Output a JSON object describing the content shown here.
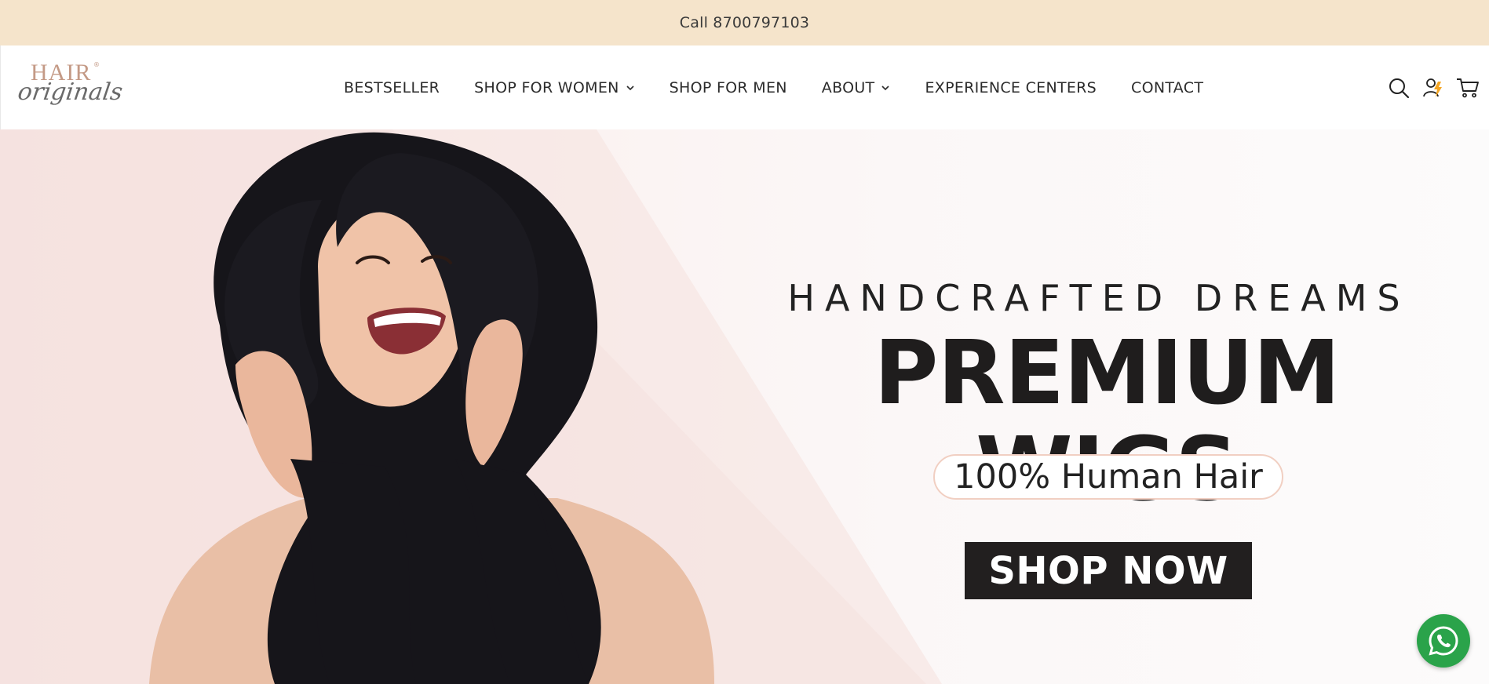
{
  "announcement": {
    "text": "Call 8700797103"
  },
  "logo": {
    "line1": "HAIR",
    "line2": "originals"
  },
  "nav": {
    "items": [
      {
        "label": "BESTSELLER"
      },
      {
        "label": "SHOP FOR WOMEN"
      },
      {
        "label": "SHOP FOR MEN"
      },
      {
        "label": "ABOUT"
      },
      {
        "label": "EXPERIENCE CENTERS"
      },
      {
        "label": "CONTACT"
      }
    ]
  },
  "header_icons": [
    "search-icon",
    "account-icon",
    "cart-icon"
  ],
  "hero": {
    "kicker": "HANDCRAFTED DREAMS",
    "title": "PREMIUM WIGS",
    "badge": "100% Human Hair",
    "cta": "SHOP NOW"
  },
  "colors": {
    "announcement_bg": "#f5e4cb",
    "cta_bg": "#221f1f",
    "whatsapp": "#2aa34a",
    "account_accent": "#f5a623"
  }
}
